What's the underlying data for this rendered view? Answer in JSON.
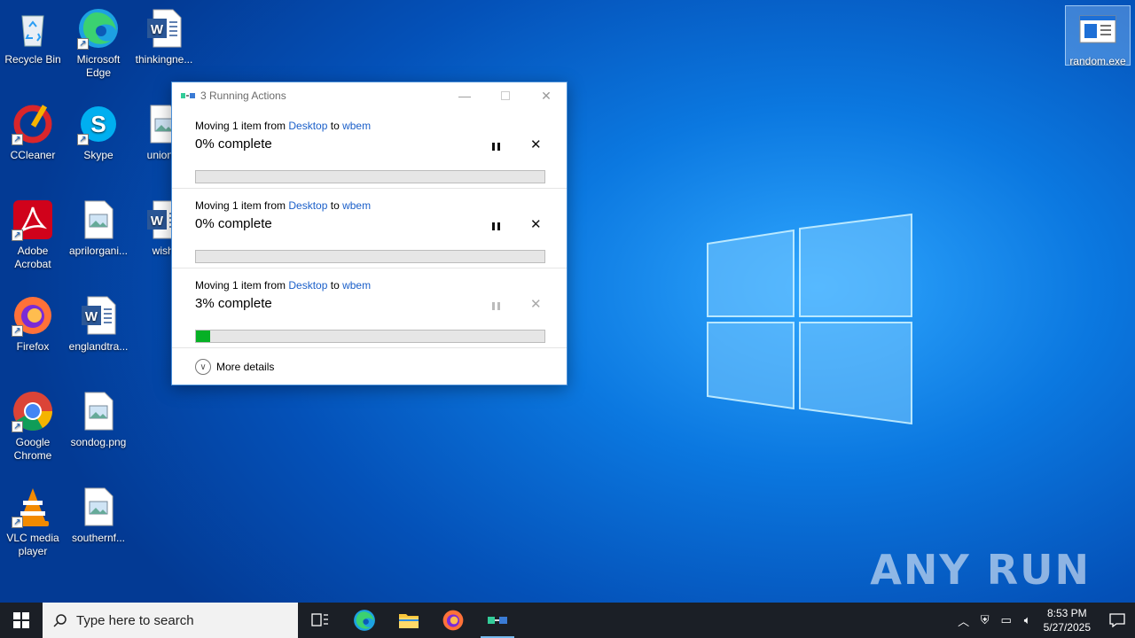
{
  "desktop": {
    "icons": [
      {
        "label": "Recycle Bin",
        "icon": "recycle-bin-icon"
      },
      {
        "label": "Microsoft Edge",
        "icon": "edge-icon"
      },
      {
        "label": "thinkingne...",
        "icon": "word-doc-icon"
      },
      {
        "label": "CCleaner",
        "icon": "ccleaner-icon"
      },
      {
        "label": "Skype",
        "icon": "skype-icon"
      },
      {
        "label": "unionst",
        "icon": "image-file-icon"
      },
      {
        "label": "Adobe Acrobat",
        "icon": "acrobat-icon"
      },
      {
        "label": "aprilorgani...",
        "icon": "image-file-icon"
      },
      {
        "label": "wishi",
        "icon": "word-doc-icon"
      },
      {
        "label": "Firefox",
        "icon": "firefox-icon"
      },
      {
        "label": "englandtra...",
        "icon": "word-doc-icon"
      },
      {
        "label": "Google Chrome",
        "icon": "chrome-icon"
      },
      {
        "label": "sondog.png",
        "icon": "image-file-icon"
      },
      {
        "label": "VLC media player",
        "icon": "vlc-icon"
      },
      {
        "label": "southernf...",
        "icon": "image-file-icon"
      },
      {
        "label": "random.exe",
        "icon": "exe-file-icon"
      }
    ],
    "watermark": "ANY RUN"
  },
  "dialog": {
    "title": "3 Running Actions",
    "actions": [
      {
        "prefix": "Moving 1 item from ",
        "source": "Desktop",
        "middle": " to ",
        "dest": "wbem",
        "status": "0% complete",
        "progress": 0,
        "controls_enabled": true
      },
      {
        "prefix": "Moving 1 item from ",
        "source": "Desktop",
        "middle": " to ",
        "dest": "wbem",
        "status": "0% complete",
        "progress": 0,
        "controls_enabled": true
      },
      {
        "prefix": "Moving 1 item from ",
        "source": "Desktop",
        "middle": " to ",
        "dest": "wbem",
        "status": "3% complete",
        "progress": 0.03,
        "controls_enabled": false
      }
    ],
    "more_details": "More details"
  },
  "taskbar": {
    "search_placeholder": "Type here to search",
    "time": "8:53 PM",
    "date": "5/27/2025"
  },
  "colors": {
    "link": "#1a5fc9",
    "progress": "#06b025",
    "taskbar": "#1b1f26"
  }
}
